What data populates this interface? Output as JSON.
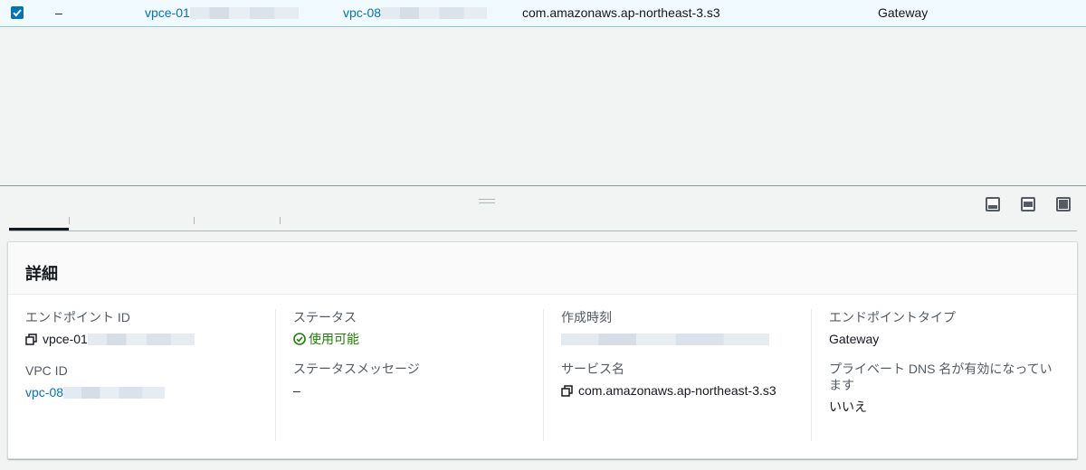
{
  "table_row": {
    "selected": true,
    "name": "–",
    "endpoint_id": "vpce-01",
    "vpc_id": "vpc-08",
    "service_name": "com.amazonaws.ap-northeast-3.s3",
    "endpoint_type": "Gateway"
  },
  "details": {
    "title": "詳細",
    "endpoint_id": {
      "label": "エンドポイント ID",
      "value": "vpce-01"
    },
    "vpc_id": {
      "label": "VPC ID",
      "value": "vpc-08"
    },
    "status": {
      "label": "ステータス",
      "value": "使用可能",
      "color": "#1d8102"
    },
    "status_message": {
      "label": "ステータスメッセージ",
      "value": "–"
    },
    "created_at": {
      "label": "作成時刻"
    },
    "service_name": {
      "label": "サービス名",
      "value": "com.amazonaws.ap-northeast-3.s3"
    },
    "endpoint_type": {
      "label": "エンドポイントタイプ",
      "value": "Gateway"
    },
    "private_dns": {
      "label": "プライベート DNS 名が有効になっています",
      "value": "いいえ"
    }
  },
  "icons": [
    "checkbox-checked-icon",
    "drag-handle-icon",
    "panel-bottom-icon",
    "panel-split-icon",
    "panel-full-icon",
    "copy-icon",
    "status-check-icon"
  ],
  "colors": {
    "link": "#0073bb",
    "selected_row": "#f1faff",
    "success": "#1d8102"
  }
}
